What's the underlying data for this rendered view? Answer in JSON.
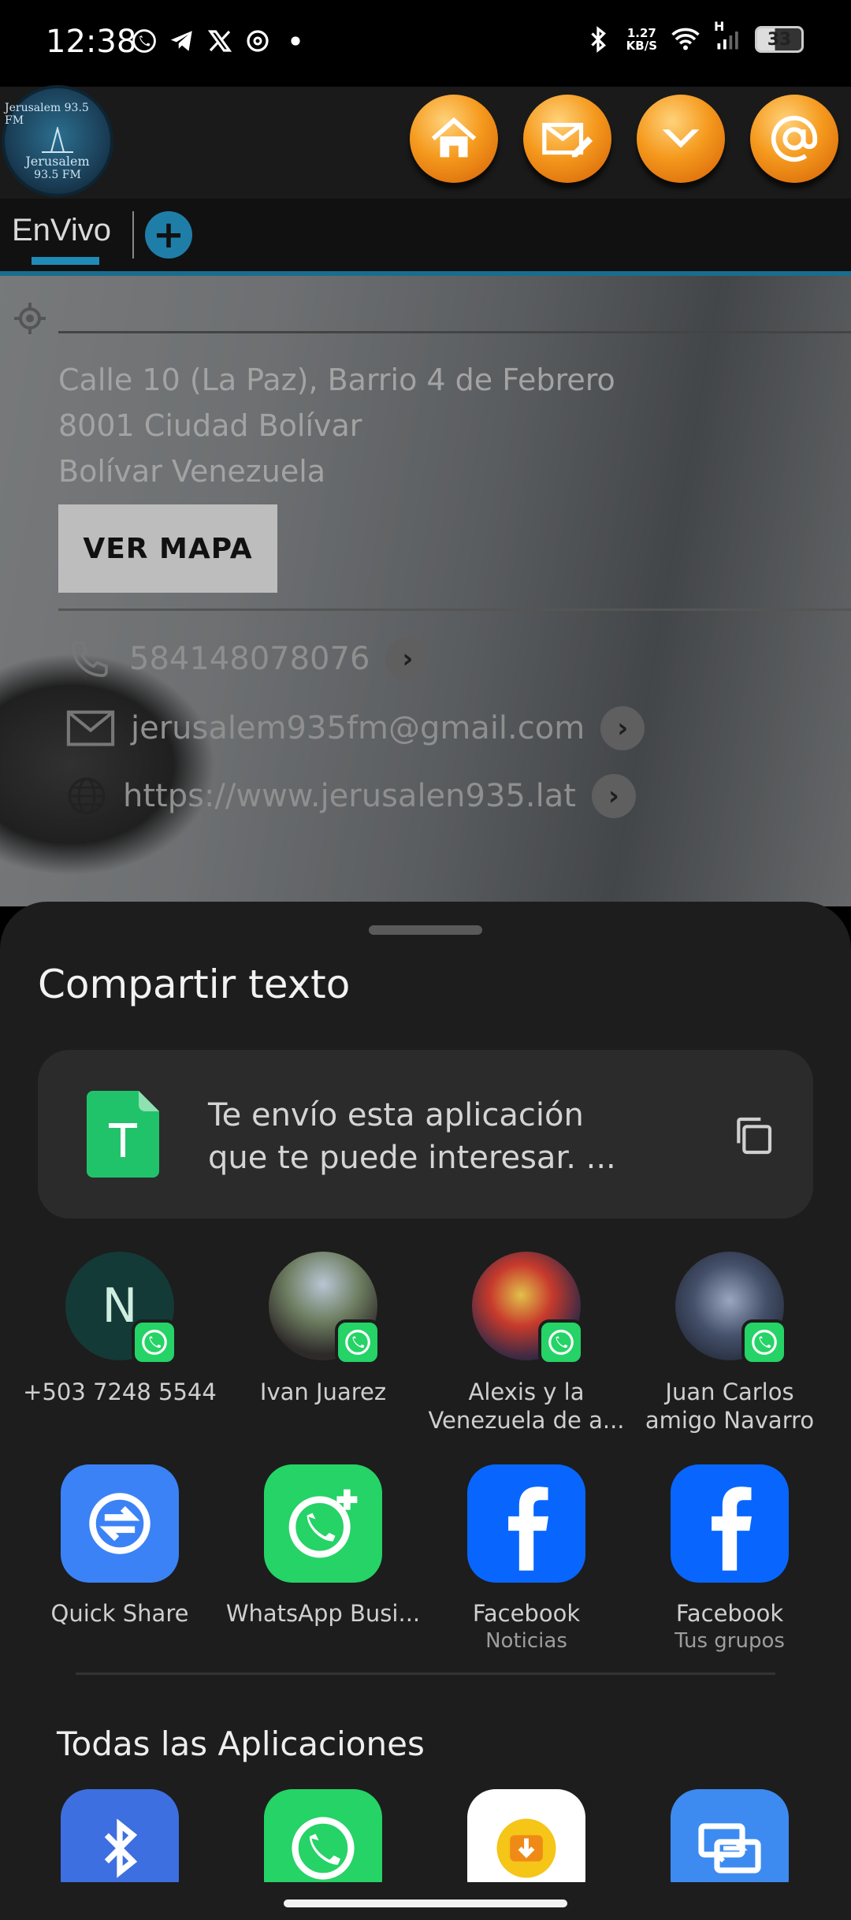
{
  "status_bar": {
    "time": "12:38",
    "speed_value": "1.27",
    "speed_unit": "KB/S",
    "network": "H",
    "battery": "33",
    "left_icons": [
      "whatsapp-icon",
      "telegram-icon",
      "x-icon",
      "threads-icon",
      "dot-icon"
    ],
    "right_icons": [
      "bluetooth-icon",
      "wifi-icon",
      "signal-icon",
      "battery-icon"
    ]
  },
  "app_header": {
    "logo_top": "Jerusalem 93.5 FM",
    "logo_name": "Jerusalem",
    "logo_freq": "93.5 FM",
    "nav": [
      "home-icon",
      "mail-edit-icon",
      "chevron-down-icon",
      "at-icon"
    ]
  },
  "tabs": {
    "active": "EnVivo",
    "add": "+"
  },
  "location": {
    "address_line1": "Calle 10 (La Paz), Barrio 4 de Febrero",
    "address_line2": "8001 Ciudad Bolívar",
    "address_line3": "Bolívar Venezuela",
    "map_button": "VER MAPA",
    "phone": "584148078076",
    "email": "jerusalem935fm@gmail.com",
    "website": "https://www.jerusalen935.lat"
  },
  "share_sheet": {
    "title": "Compartir texto",
    "preview_line1": "Te envío esta aplicación",
    "preview_line2": "que te puede interesar.  ...",
    "contacts": [
      {
        "name": "+503 7248 5544",
        "initial": "N"
      },
      {
        "name": "Ivan Juarez",
        "initial": ""
      },
      {
        "name_line1": "Alexis y la",
        "name_line2": "Venezuela de a...",
        "initial": ""
      },
      {
        "name_line1": "Juan Carlos",
        "name_line2": "amigo Navarro",
        "initial": ""
      }
    ],
    "apps": [
      {
        "name": "Quick Share",
        "sub": "",
        "color": "#3b82f6"
      },
      {
        "name": "WhatsApp Busi...",
        "sub": "",
        "color": "#25d366"
      },
      {
        "name": "Facebook",
        "sub": "Noticias",
        "color": "#0866ff"
      },
      {
        "name": "Facebook",
        "sub": "Tus grupos",
        "color": "#0866ff"
      }
    ],
    "all_apps_title": "Todas las Aplicaciones",
    "all_apps": [
      "bluetooth-app",
      "whatsapp-app",
      "downloader-app",
      "screen-share-app"
    ]
  },
  "colors": {
    "accent": "#1f8cb5",
    "sheet_bg": "#1d1d1d",
    "whatsapp": "#25d366",
    "facebook": "#0866ff"
  }
}
